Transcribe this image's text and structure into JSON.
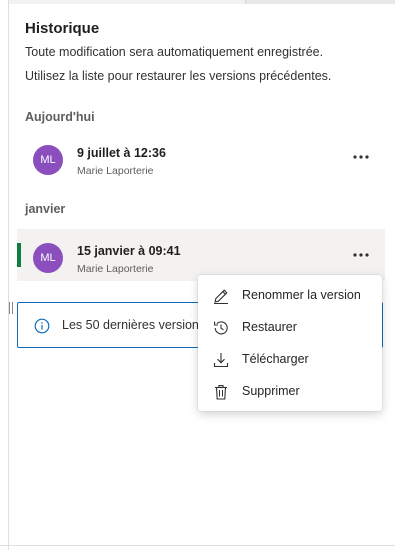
{
  "panel": {
    "title": "Historique",
    "description_line1": "Toute modification sera automatiquement enregistrée.",
    "description_line2": "Utilisez la liste pour restaurer les versions précédentes."
  },
  "sections": [
    {
      "label": "Aujourd'hui",
      "versions": [
        {
          "date": "9 juillet à 12:36",
          "user": "Marie Laporterie",
          "initials": "ML"
        }
      ]
    },
    {
      "label": "janvier",
      "versions": [
        {
          "date": "15 janvier à 09:41",
          "user": "Marie Laporterie",
          "initials": "ML",
          "selected": true
        }
      ]
    }
  ],
  "info_banner": {
    "text": "Les 50 dernières versions",
    "icon": "info-icon"
  },
  "context_menu": {
    "items": [
      {
        "label": "Renommer la version",
        "icon": "pencil-icon"
      },
      {
        "label": "Restaurer",
        "icon": "restore-clock-icon"
      },
      {
        "label": "Télécharger",
        "icon": "download-icon"
      },
      {
        "label": "Supprimer",
        "icon": "trash-icon"
      }
    ]
  },
  "colors": {
    "avatar": "#8a4fbd",
    "selection_bar": "#107c41",
    "info_border": "#0f6cbd",
    "selected_row_bg": "#f3f2f1"
  }
}
